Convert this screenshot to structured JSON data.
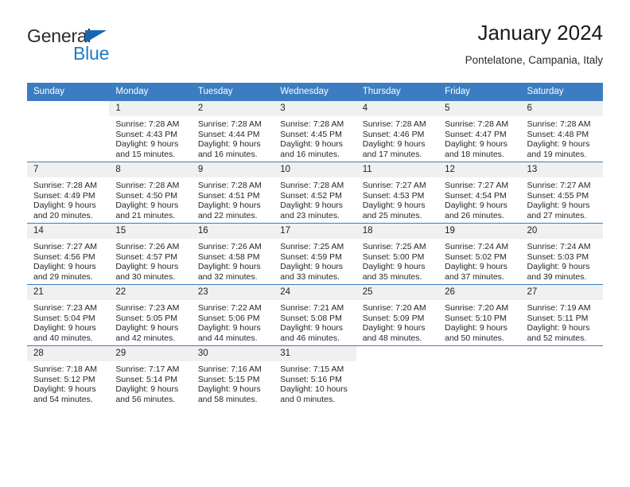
{
  "brand": {
    "name_part1": "General",
    "name_part2": "Blue",
    "triangle_icon": "triangle-icon",
    "colors": {
      "blue": "#1f7bc4",
      "dark": "#2b2b2b"
    }
  },
  "header": {
    "title": "January 2024",
    "subtitle": "Pontelatone, Campania, Italy"
  },
  "calendar": {
    "header_bg": "#3b7dc0",
    "daynum_bg": "#f0f0f0",
    "weekdays": [
      "Sunday",
      "Monday",
      "Tuesday",
      "Wednesday",
      "Thursday",
      "Friday",
      "Saturday"
    ],
    "weeks": [
      [
        {
          "day": "",
          "text": ""
        },
        {
          "day": "1",
          "text": "Sunrise: 7:28 AM\nSunset: 4:43 PM\nDaylight: 9 hours\nand 15 minutes."
        },
        {
          "day": "2",
          "text": "Sunrise: 7:28 AM\nSunset: 4:44 PM\nDaylight: 9 hours\nand 16 minutes."
        },
        {
          "day": "3",
          "text": "Sunrise: 7:28 AM\nSunset: 4:45 PM\nDaylight: 9 hours\nand 16 minutes."
        },
        {
          "day": "4",
          "text": "Sunrise: 7:28 AM\nSunset: 4:46 PM\nDaylight: 9 hours\nand 17 minutes."
        },
        {
          "day": "5",
          "text": "Sunrise: 7:28 AM\nSunset: 4:47 PM\nDaylight: 9 hours\nand 18 minutes."
        },
        {
          "day": "6",
          "text": "Sunrise: 7:28 AM\nSunset: 4:48 PM\nDaylight: 9 hours\nand 19 minutes."
        }
      ],
      [
        {
          "day": "7",
          "text": "Sunrise: 7:28 AM\nSunset: 4:49 PM\nDaylight: 9 hours\nand 20 minutes."
        },
        {
          "day": "8",
          "text": "Sunrise: 7:28 AM\nSunset: 4:50 PM\nDaylight: 9 hours\nand 21 minutes."
        },
        {
          "day": "9",
          "text": "Sunrise: 7:28 AM\nSunset: 4:51 PM\nDaylight: 9 hours\nand 22 minutes."
        },
        {
          "day": "10",
          "text": "Sunrise: 7:28 AM\nSunset: 4:52 PM\nDaylight: 9 hours\nand 23 minutes."
        },
        {
          "day": "11",
          "text": "Sunrise: 7:27 AM\nSunset: 4:53 PM\nDaylight: 9 hours\nand 25 minutes."
        },
        {
          "day": "12",
          "text": "Sunrise: 7:27 AM\nSunset: 4:54 PM\nDaylight: 9 hours\nand 26 minutes."
        },
        {
          "day": "13",
          "text": "Sunrise: 7:27 AM\nSunset: 4:55 PM\nDaylight: 9 hours\nand 27 minutes."
        }
      ],
      [
        {
          "day": "14",
          "text": "Sunrise: 7:27 AM\nSunset: 4:56 PM\nDaylight: 9 hours\nand 29 minutes."
        },
        {
          "day": "15",
          "text": "Sunrise: 7:26 AM\nSunset: 4:57 PM\nDaylight: 9 hours\nand 30 minutes."
        },
        {
          "day": "16",
          "text": "Sunrise: 7:26 AM\nSunset: 4:58 PM\nDaylight: 9 hours\nand 32 minutes."
        },
        {
          "day": "17",
          "text": "Sunrise: 7:25 AM\nSunset: 4:59 PM\nDaylight: 9 hours\nand 33 minutes."
        },
        {
          "day": "18",
          "text": "Sunrise: 7:25 AM\nSunset: 5:00 PM\nDaylight: 9 hours\nand 35 minutes."
        },
        {
          "day": "19",
          "text": "Sunrise: 7:24 AM\nSunset: 5:02 PM\nDaylight: 9 hours\nand 37 minutes."
        },
        {
          "day": "20",
          "text": "Sunrise: 7:24 AM\nSunset: 5:03 PM\nDaylight: 9 hours\nand 39 minutes."
        }
      ],
      [
        {
          "day": "21",
          "text": "Sunrise: 7:23 AM\nSunset: 5:04 PM\nDaylight: 9 hours\nand 40 minutes."
        },
        {
          "day": "22",
          "text": "Sunrise: 7:23 AM\nSunset: 5:05 PM\nDaylight: 9 hours\nand 42 minutes."
        },
        {
          "day": "23",
          "text": "Sunrise: 7:22 AM\nSunset: 5:06 PM\nDaylight: 9 hours\nand 44 minutes."
        },
        {
          "day": "24",
          "text": "Sunrise: 7:21 AM\nSunset: 5:08 PM\nDaylight: 9 hours\nand 46 minutes."
        },
        {
          "day": "25",
          "text": "Sunrise: 7:20 AM\nSunset: 5:09 PM\nDaylight: 9 hours\nand 48 minutes."
        },
        {
          "day": "26",
          "text": "Sunrise: 7:20 AM\nSunset: 5:10 PM\nDaylight: 9 hours\nand 50 minutes."
        },
        {
          "day": "27",
          "text": "Sunrise: 7:19 AM\nSunset: 5:11 PM\nDaylight: 9 hours\nand 52 minutes."
        }
      ],
      [
        {
          "day": "28",
          "text": "Sunrise: 7:18 AM\nSunset: 5:12 PM\nDaylight: 9 hours\nand 54 minutes."
        },
        {
          "day": "29",
          "text": "Sunrise: 7:17 AM\nSunset: 5:14 PM\nDaylight: 9 hours\nand 56 minutes."
        },
        {
          "day": "30",
          "text": "Sunrise: 7:16 AM\nSunset: 5:15 PM\nDaylight: 9 hours\nand 58 minutes."
        },
        {
          "day": "31",
          "text": "Sunrise: 7:15 AM\nSunset: 5:16 PM\nDaylight: 10 hours\nand 0 minutes."
        },
        {
          "day": "",
          "text": ""
        },
        {
          "day": "",
          "text": ""
        },
        {
          "day": "",
          "text": ""
        }
      ]
    ]
  }
}
